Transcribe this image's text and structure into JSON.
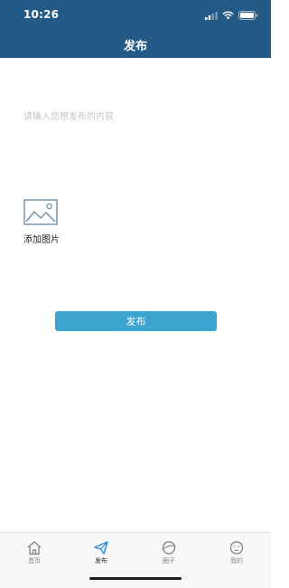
{
  "status_bar": {
    "time": "10:26",
    "icons": [
      "signal-icon",
      "wifi-icon",
      "battery-icon"
    ]
  },
  "header": {
    "title": "发布"
  },
  "post": {
    "content_placeholder": "请输入您想发布的内容",
    "content_value": "",
    "add_image_label": "添加图片",
    "publish_label": "发布"
  },
  "tabs": [
    {
      "label": "首页",
      "icon": "home-icon",
      "active": false
    },
    {
      "label": "发布",
      "icon": "paper-plane-icon",
      "active": true
    },
    {
      "label": "圈子",
      "icon": "planet-icon",
      "active": false
    },
    {
      "label": "我的",
      "icon": "face-icon",
      "active": false
    }
  ],
  "colors": {
    "header_bg": "#245a86",
    "button_bg": "#3ca4d0",
    "active_icon": "#2b8ed8",
    "inactive_icon": "#8a8a8a"
  }
}
